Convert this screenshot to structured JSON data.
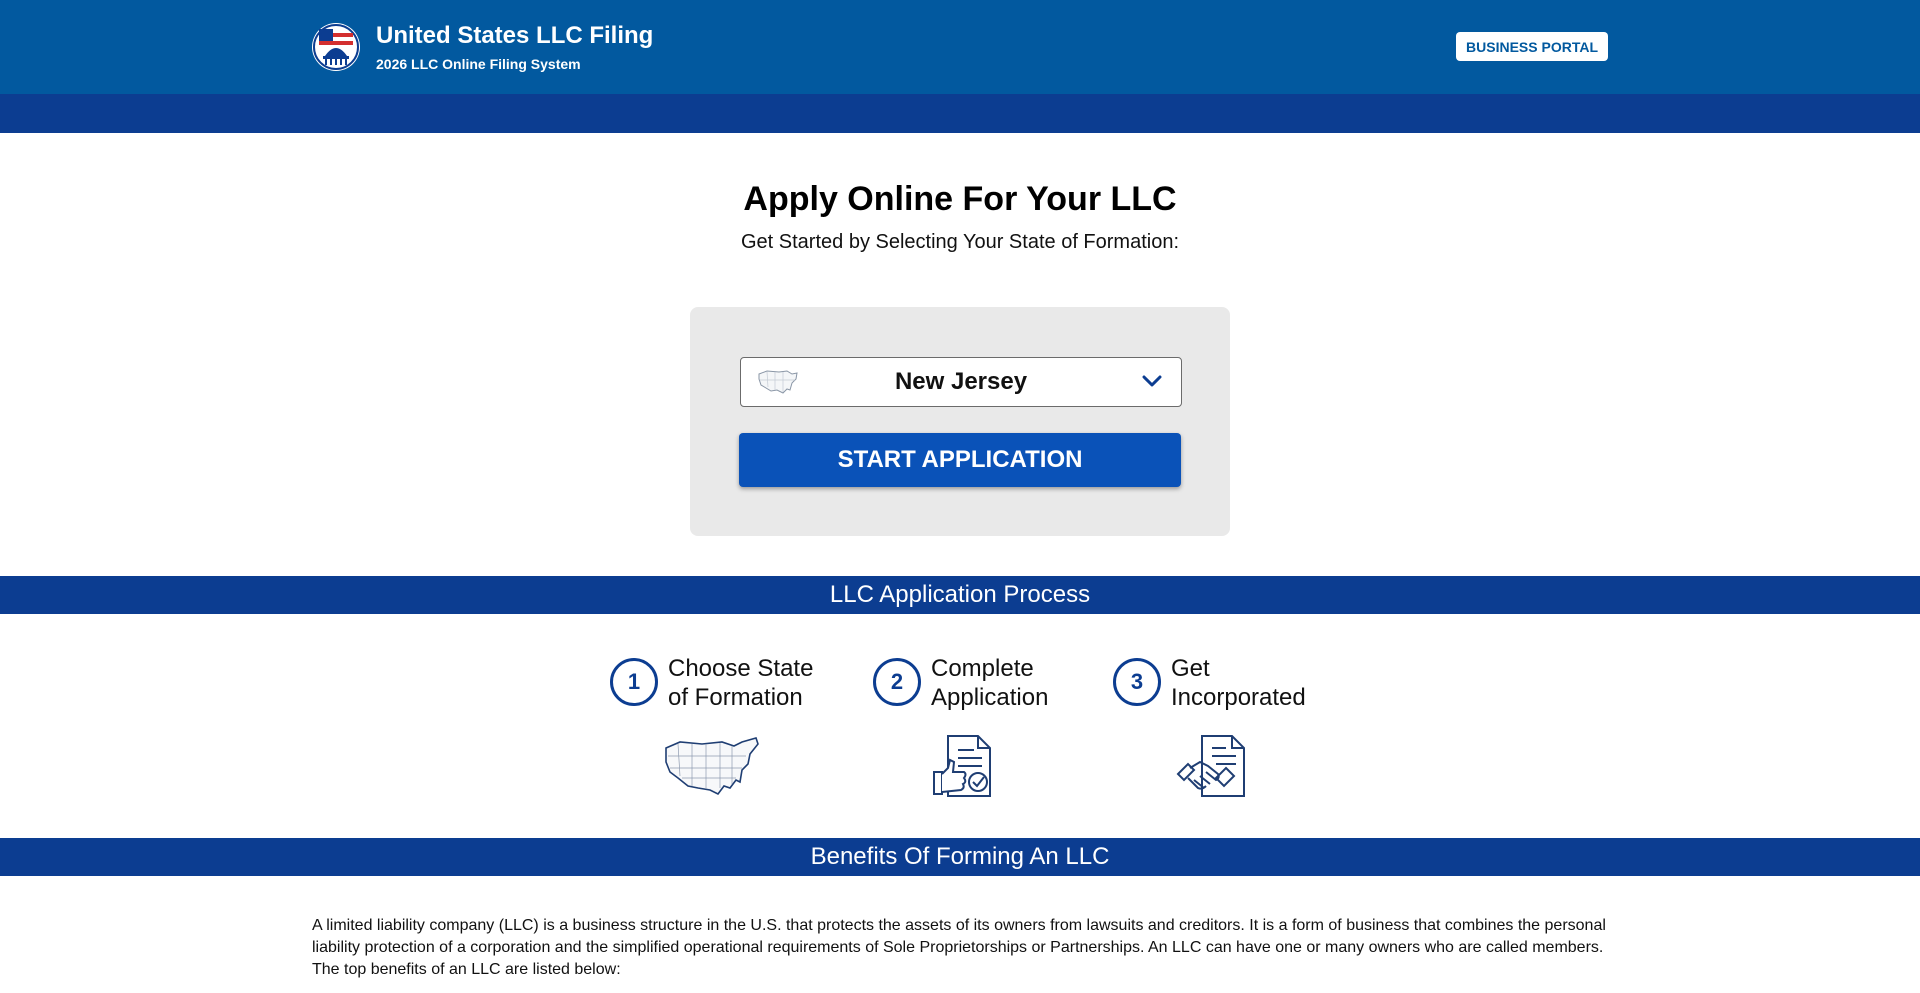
{
  "header": {
    "title": "United States LLC Filing",
    "subtitle": "2026 LLC Online Filing System",
    "portal_button": "BUSINESS PORTAL"
  },
  "hero": {
    "title": "Apply Online For Your LLC",
    "lead": "Get Started by Selecting Your State of Formation:"
  },
  "form": {
    "state_selected": "New Jersey",
    "start_button": "START APPLICATION"
  },
  "process": {
    "heading": "LLC Application Process",
    "steps": [
      {
        "number": "1",
        "line1": "Choose State",
        "line2": "of Formation"
      },
      {
        "number": "2",
        "line1": "Complete",
        "line2": "Application"
      },
      {
        "number": "3",
        "line1": "Get",
        "line2": "Incorporated"
      }
    ]
  },
  "benefits": {
    "heading": "Benefits Of Forming An LLC",
    "paragraph": "A limited liability company (LLC) is a business structure in the U.S. that protects the assets of its owners from lawsuits and creditors. It is a form of business that combines the personal liability protection of a corporation and the simplified operational requirements of Sole Proprietorships or Partnerships. An LLC can have one or many owners who are called members. The top benefits of an LLC are listed below:"
  },
  "colors": {
    "header": "#02599f",
    "band": "#0c3d91",
    "button": "#0a52b8",
    "panel": "#e9e9e9"
  },
  "icons": {
    "logo": "capitol-flag-logo-icon",
    "select_map": "usa-map-icon",
    "chevron": "chevron-down-icon",
    "step1": "usa-map-icon",
    "step2": "document-thumbs-up-icon",
    "step3": "handshake-document-icon"
  }
}
